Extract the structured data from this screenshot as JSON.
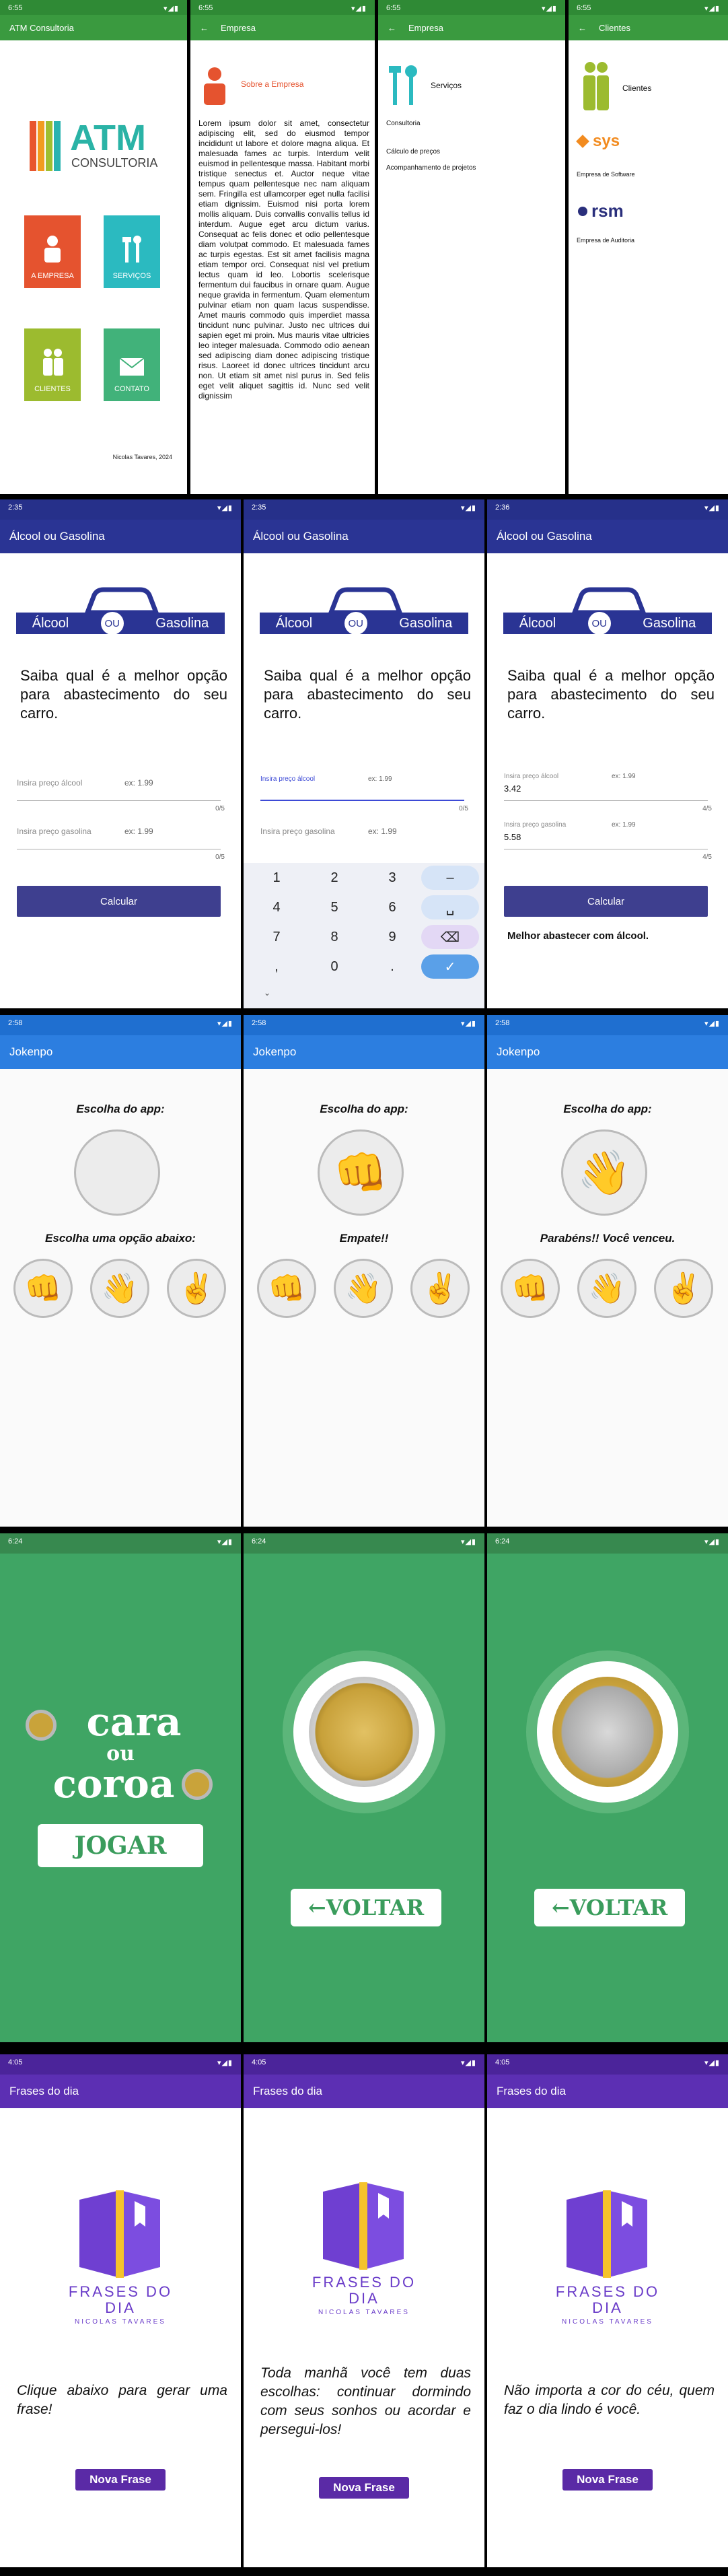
{
  "atm": {
    "home": {
      "time": "6:55",
      "title": "ATM Consultoria",
      "logo_text": "ATM",
      "logo_sub": "CONSULTORIA",
      "tiles": [
        "A EMPRESA",
        "SERVIÇOS",
        "CLIENTES",
        "CONTATO"
      ],
      "footer": "Nicolas Tavares, 2024"
    },
    "empresa": {
      "time": "6:55",
      "title": "Empresa",
      "section": "Sobre a Empresa",
      "body": "Lorem ipsum dolor sit amet, consectetur adipiscing elit, sed do eiusmod tempor incididunt ut labore et dolore magna aliqua. Et malesuada fames ac turpis. Interdum velit euismod in pellentesque massa. Habitant morbi tristique senectus et. Auctor neque vitae tempus quam pellentesque nec nam aliquam sem. Fringilla est ullamcorper eget nulla facilisi etiam dignissim. Euismod nisi porta lorem mollis aliquam. Duis convallis convallis tellus id interdum. Augue eget arcu dictum varius. Consequat ac felis donec et odio pellentesque diam volutpat commodo. Et malesuada fames ac turpis egestas. Est sit amet facilisis magna etiam tempor orci. Consequat nisl vel pretium lectus quam id leo. Lobortis scelerisque fermentum dui faucibus in ornare quam. Augue neque gravida in fermentum. Quam elementum pulvinar etiam non quam lacus suspendisse. Amet mauris commodo quis imperdiet massa tincidunt nunc pulvinar. Justo nec ultrices dui sapien eget mi proin. Mus mauris vitae ultricies leo integer malesuada. Commodo odio aenean sed adipiscing diam donec adipiscing tristique risus. Laoreet id donec ultrices tincidunt arcu non. Ut etiam sit amet nisl purus in. Sed felis eget velit aliquet sagittis id. Nunc sed velit dignissim"
    },
    "servicos": {
      "time": "6:55",
      "title": "Empresa",
      "section": "Serviços",
      "items": [
        "Consultoria",
        "Cálculo de preços",
        "Acompanhamento de projetos"
      ]
    },
    "clientes": {
      "time": "6:55",
      "title": "Clientes",
      "section": "Clientes",
      "c1": "sys",
      "c1_desc": "Empresa de Software",
      "c2": "rsm",
      "c2_desc": "Empresa de Auditoria"
    }
  },
  "alcool": {
    "title": "Álcool ou Gasolina",
    "logo_left": "Álcool",
    "logo_mid": "OU",
    "logo_right": "Gasolina",
    "headline": "Saiba qual é a melhor opção para abastecimento do seu carro.",
    "label_alcool": "Insira preço álcool",
    "label_gas": "Insira preço gasolina",
    "hint": "ex: 1.99",
    "button": "Calcular",
    "s1": {
      "time": "2:35",
      "counter_a": "0/5",
      "counter_g": "0/5"
    },
    "s2": {
      "time": "2:35",
      "counter_a": "0/5",
      "keys": [
        "1",
        "2",
        "3",
        "–",
        "4",
        "5",
        "6",
        "␣",
        "7",
        "8",
        "9",
        "⌫",
        ",",
        "0",
        ".",
        "✓"
      ]
    },
    "s3": {
      "time": "2:36",
      "value_a": "3.42",
      "value_g": "5.58",
      "counter_a": "4/5",
      "counter_g": "4/5",
      "result": "Melhor abastecer com álcool."
    }
  },
  "jokenpo": {
    "title": "Jokenpo",
    "time": "2:58",
    "app_choice": "Escolha do app:",
    "prompt": "Escolha uma opção abaixo:",
    "draw": "Empate!!",
    "win": "Parabéns!! Você venceu.",
    "rock": "👊",
    "paper": "👋",
    "scissors": "✌️"
  },
  "cara": {
    "time": "6:24",
    "word_cara": "cara",
    "word_ou": "ou",
    "word_coroa": "coroa",
    "play": "JOGAR",
    "back": "VOLTAR"
  },
  "frases": {
    "title": "Frases do dia",
    "time": "4:05",
    "logo_l1": "FRASES DO",
    "logo_l2": "DIA",
    "author": "NICOLAS TAVARES",
    "p1": "Clique abaixo para gerar uma frase!",
    "p2": "Toda manhã você tem duas escolhas: continuar dormindo com seus sonhos ou acordar e persegui-los!",
    "p3": "Não importa a cor do céu, quem faz o dia lindo é você.",
    "button": "Nova Frase"
  },
  "colors": {
    "atm_green": "#3a9a3f",
    "alcool_bar": "#2a3494",
    "jokenpo_bar": "#2c7ee0",
    "cara_green": "#3fa564",
    "frases_bar": "#5c2fb3"
  }
}
